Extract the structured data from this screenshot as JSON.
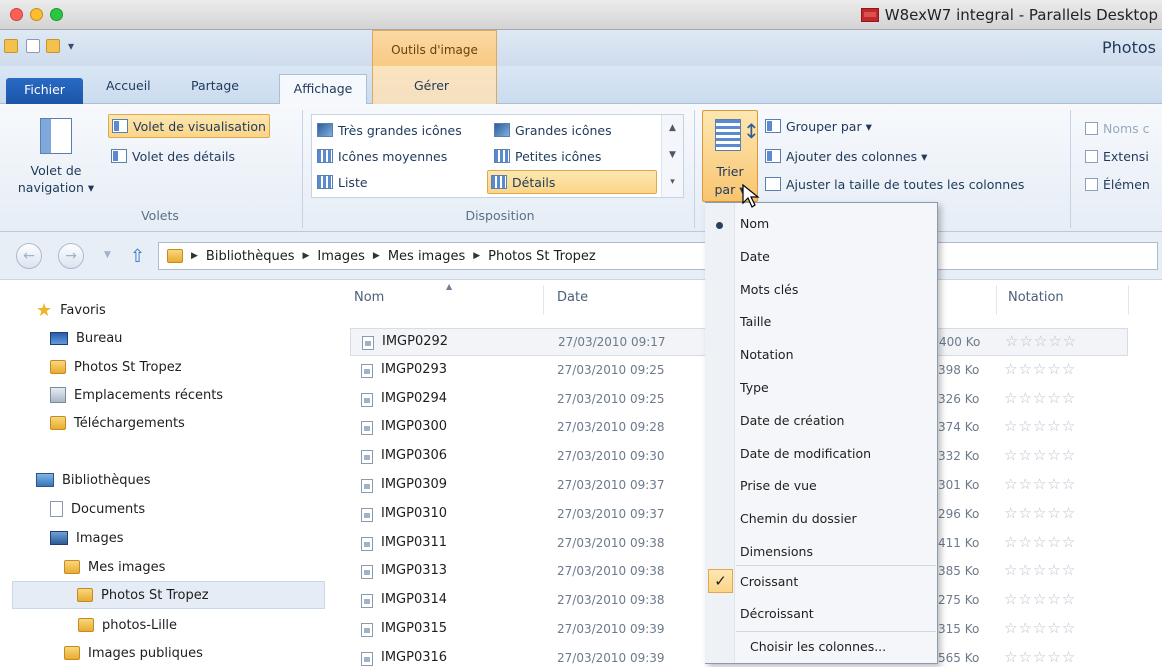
{
  "mac": {
    "window_title": "W8exW7 integral - Parallels Desktop",
    "traffic_colors": [
      "#ff5f57",
      "#febc2e",
      "#28c840"
    ]
  },
  "explorer": {
    "window_title": "Photos",
    "context_tab_group": "Outils d'image"
  },
  "tabs": [
    "Fichier",
    "Accueil",
    "Partage",
    "Affichage",
    "Gérer"
  ],
  "ribbon": {
    "volets": {
      "nav_pane": "Volet de navigation",
      "nav_pane_line1": "Volet de",
      "nav_pane_line2": "navigation ▾",
      "preview_pane": "Volet de visualisation",
      "details_pane": "Volet des détails",
      "group_label": "Volets"
    },
    "disposition": {
      "items": [
        "Très grandes icônes",
        "Grandes icônes",
        "Icônes moyennes",
        "Petites icônes",
        "Liste",
        "Détails"
      ],
      "group_label": "Disposition"
    },
    "affichage_actuel": {
      "sort_line1": "Trier",
      "sort_line2": "par ▾",
      "group_by": "Grouper par ▾",
      "add_columns": "Ajouter des colonnes ▾",
      "fit_columns": "Ajuster la taille de toutes les colonnes"
    },
    "afficher_masquer": {
      "checkboxes": [
        "Noms c",
        "Extensi",
        "Élémen"
      ]
    }
  },
  "breadcrumb": [
    "Bibliothèques",
    "Images",
    "Mes images",
    "Photos St Tropez"
  ],
  "navigation": {
    "favorites_label": "Favoris",
    "favorites": [
      "Bureau",
      "Photos St Tropez",
      "Emplacements récents",
      "Téléchargements"
    ],
    "libraries_label": "Bibliothèques",
    "libraries": [
      "Documents",
      "Images",
      "Mes images",
      "Photos St Tropez",
      "photos-Lille",
      "Images publiques"
    ]
  },
  "columns": {
    "name": "Nom",
    "date": "Date",
    "rating": "Notation"
  },
  "files": [
    {
      "name": "IMGP0292",
      "date": "27/03/2010 09:17",
      "size": "400 Ko"
    },
    {
      "name": "IMGP0293",
      "date": "27/03/2010 09:25",
      "size": "398 Ko"
    },
    {
      "name": "IMGP0294",
      "date": "27/03/2010 09:25",
      "size": "326 Ko"
    },
    {
      "name": "IMGP0300",
      "date": "27/03/2010 09:28",
      "size": "374 Ko"
    },
    {
      "name": "IMGP0306",
      "date": "27/03/2010 09:30",
      "size": "332 Ko"
    },
    {
      "name": "IMGP0309",
      "date": "27/03/2010 09:37",
      "size": "301 Ko"
    },
    {
      "name": "IMGP0310",
      "date": "27/03/2010 09:37",
      "size": "296 Ko"
    },
    {
      "name": "IMGP0311",
      "date": "27/03/2010 09:38",
      "size": "411 Ko"
    },
    {
      "name": "IMGP0313",
      "date": "27/03/2010 09:38",
      "size": "385 Ko"
    },
    {
      "name": "IMGP0314",
      "date": "27/03/2010 09:38",
      "size": "275 Ko"
    },
    {
      "name": "IMGP0315",
      "date": "27/03/2010 09:39",
      "size": "315 Ko"
    },
    {
      "name": "IMGP0316",
      "date": "27/03/2010 09:39",
      "size": "565 Ko"
    }
  ],
  "stars": "☆☆☆☆☆",
  "sort_menu": {
    "fields": [
      "Nom",
      "Date",
      "Mots clés",
      "Taille",
      "Notation",
      "Type",
      "Date de création",
      "Date de modification",
      "Prise de vue",
      "Chemin du dossier",
      "Dimensions"
    ],
    "selected_field": "Nom",
    "order": [
      "Croissant",
      "Décroissant"
    ],
    "selected_order": "Croissant",
    "choose_columns": "Choisir les colonnes..."
  }
}
